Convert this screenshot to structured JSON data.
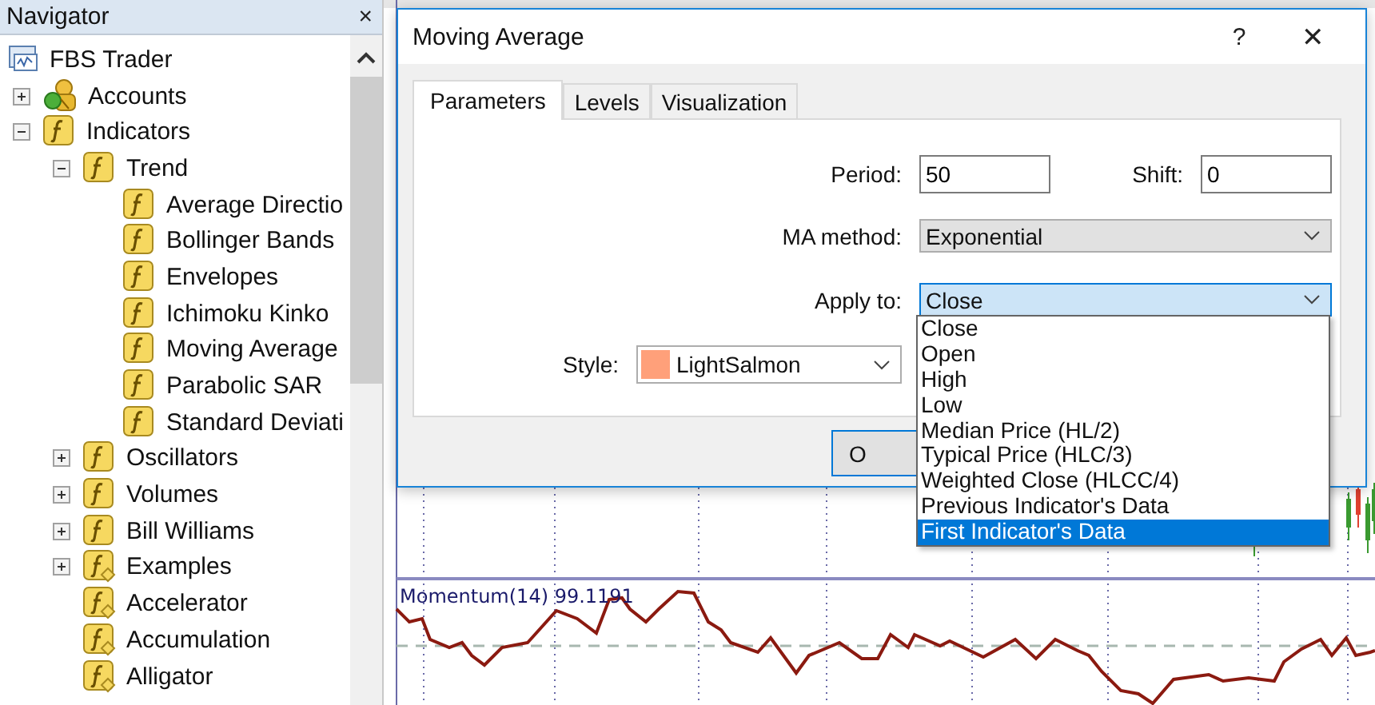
{
  "navigator": {
    "title": "Navigator",
    "close": "×",
    "tree": [
      {
        "label": "FBS Trader",
        "kind": "terminal",
        "children": [
          {
            "label": "Accounts",
            "kind": "accounts",
            "expanded": false
          },
          {
            "label": "Indicators",
            "kind": "function",
            "expanded": true,
            "children": [
              {
                "label": "Trend",
                "kind": "function",
                "expanded": true,
                "children": [
                  {
                    "label": "Average Directio",
                    "kind": "function"
                  },
                  {
                    "label": "Bollinger Bands",
                    "kind": "function"
                  },
                  {
                    "label": "Envelopes",
                    "kind": "function"
                  },
                  {
                    "label": "Ichimoku Kinko",
                    "kind": "function"
                  },
                  {
                    "label": "Moving Average",
                    "kind": "function"
                  },
                  {
                    "label": "Parabolic SAR",
                    "kind": "function"
                  },
                  {
                    "label": "Standard Deviati",
                    "kind": "function"
                  }
                ]
              },
              {
                "label": "Oscillators",
                "kind": "function",
                "expanded": false
              },
              {
                "label": "Volumes",
                "kind": "function",
                "expanded": false
              },
              {
                "label": "Bill Williams",
                "kind": "function",
                "expanded": false
              },
              {
                "label": "Examples",
                "kind": "custom",
                "expanded": false
              },
              {
                "label": "Accelerator",
                "kind": "custom"
              },
              {
                "label": "Accumulation",
                "kind": "custom"
              },
              {
                "label": "Alligator",
                "kind": "custom"
              }
            ]
          }
        ]
      }
    ]
  },
  "chart": {
    "indicator_label": "Momentum(14) 99.1191"
  },
  "dialog": {
    "title": "Moving Average",
    "help": "?",
    "close": "✕",
    "tabs": [
      {
        "label": "Parameters",
        "selected": true
      },
      {
        "label": "Levels",
        "selected": false
      },
      {
        "label": "Visualization",
        "selected": false
      }
    ],
    "period": {
      "label": "Period:",
      "value": "50"
    },
    "shift": {
      "label": "Shift:",
      "value": "0"
    },
    "ma_method": {
      "label": "MA method:",
      "value": "Exponential"
    },
    "apply_to": {
      "label": "Apply to:",
      "value": "Close",
      "expanded": true,
      "options": [
        {
          "label": "Close",
          "highlighted": false
        },
        {
          "label": "Open",
          "highlighted": false
        },
        {
          "label": "High",
          "highlighted": false
        },
        {
          "label": "Low",
          "highlighted": false
        },
        {
          "label": "Median Price (HL/2)",
          "highlighted": false
        },
        {
          "label": "Typical Price (HLC/3)",
          "highlighted": false
        },
        {
          "label": "Weighted Close (HLCC/4)",
          "highlighted": false
        },
        {
          "label": "Previous Indicator's Data",
          "highlighted": false
        },
        {
          "label": "First Indicator's Data",
          "highlighted": true
        }
      ]
    },
    "style": {
      "label": "Style:",
      "value": "LightSalmon",
      "color": "#ffa07a"
    },
    "ok_button": {
      "label": "O"
    }
  }
}
